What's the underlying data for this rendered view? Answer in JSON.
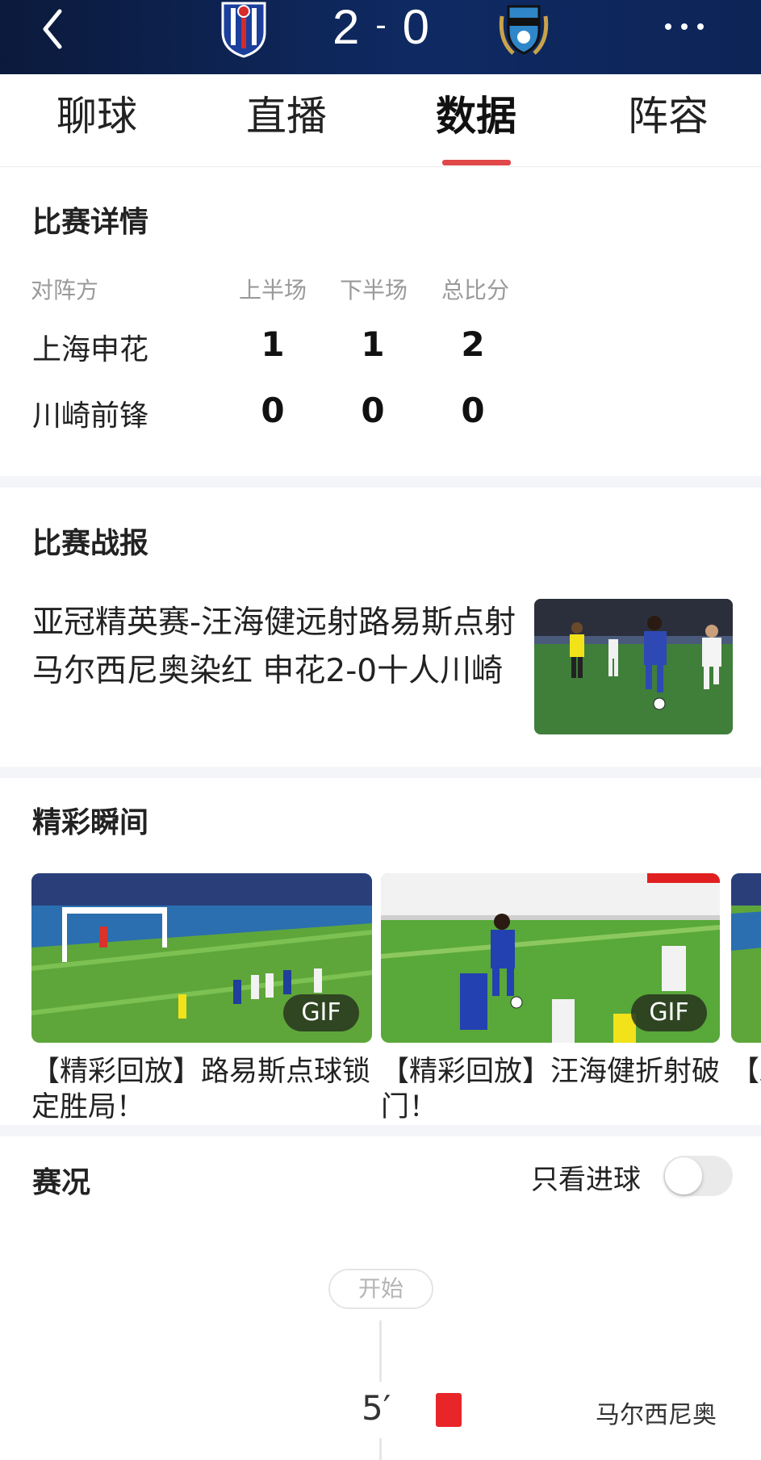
{
  "header": {
    "home_score": "2",
    "separator": "-",
    "away_score": "0",
    "accent": "#0f2a63"
  },
  "tabs": [
    {
      "label": "聊球"
    },
    {
      "label": "直播"
    },
    {
      "label": "数据",
      "active": true
    },
    {
      "label": "阵容"
    }
  ],
  "details": {
    "title": "比赛详情",
    "columns": [
      "对阵方",
      "上半场",
      "下半场",
      "总比分"
    ],
    "rows": [
      {
        "team": "上海申花",
        "first_half": "1",
        "second_half": "1",
        "total": "2"
      },
      {
        "team": "川崎前锋",
        "first_half": "0",
        "second_half": "0",
        "total": "0"
      }
    ]
  },
  "report": {
    "title": "比赛战报",
    "headline": "亚冠精英赛-汪海健远射路易斯点射马尔西尼奥染红 申花2-0十人川崎"
  },
  "highlights": {
    "title": "精彩瞬间",
    "items": [
      {
        "badge": "GIF",
        "title": "【精彩回放】路易斯点球锁定胜局！"
      },
      {
        "badge": "GIF",
        "title": "【精彩回放】汪海健折射破门！"
      },
      {
        "badge": "",
        "title": "【左"
      }
    ]
  },
  "events": {
    "title": "赛况",
    "goals_only_label": "只看进球",
    "goals_only": false,
    "start_label": "开始",
    "items": [
      {
        "minute": "5′",
        "type": "red-card",
        "player": "马尔西尼奥",
        "color": "#e8262a"
      }
    ]
  }
}
